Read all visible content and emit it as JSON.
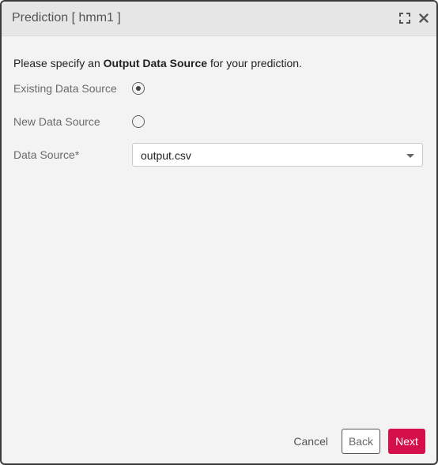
{
  "dialog": {
    "title": "Prediction [ hmm1 ]",
    "icons": {
      "maximize": "maximize-icon",
      "close": "close-icon"
    }
  },
  "instruction": {
    "prefix": "Please specify an ",
    "emphasis": "Output Data Source",
    "suffix": " for your prediction."
  },
  "options": {
    "existing": {
      "label": "Existing Data Source",
      "selected": true
    },
    "new": {
      "label": "New Data Source",
      "selected": false
    }
  },
  "data_source": {
    "label": "Data Source*",
    "value": "output.csv"
  },
  "footer": {
    "cancel_label": "Cancel",
    "back_label": "Back",
    "next_label": "Next"
  },
  "colors": {
    "accent": "#d40f4a",
    "title_bar": "#e6e6e6",
    "body": "#f3f3f3"
  }
}
